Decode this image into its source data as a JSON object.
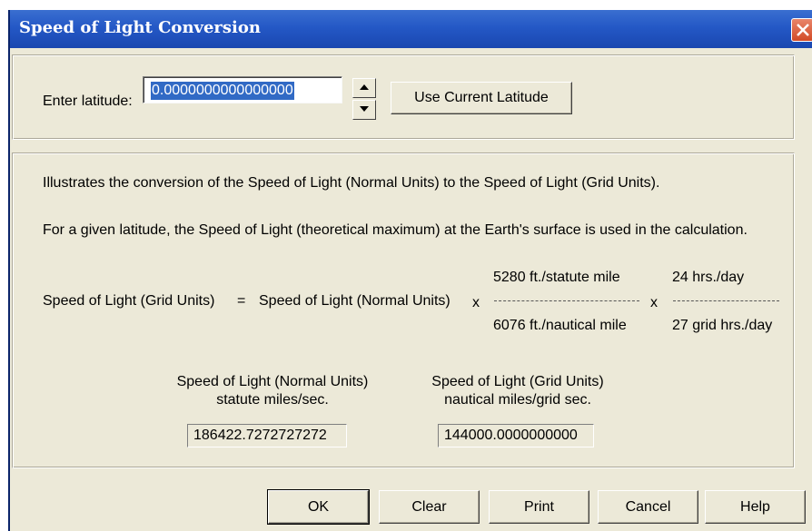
{
  "window": {
    "title": "Speed of Light Conversion",
    "close_label": "close"
  },
  "latitude": {
    "label": "Enter latitude:",
    "value": "0.0000000000000000",
    "use_current_label": "Use Current Latitude"
  },
  "info": {
    "line1": "Illustrates the conversion of the Speed of Light (Normal Units) to the Speed of Light (Grid Units).",
    "line2": "For a given latitude, the Speed of Light (theoretical maximum) at the Earth's surface is used in the calculation."
  },
  "formula": {
    "lhs": "Speed of Light (Grid Units)",
    "equals": "=",
    "rhs": "Speed of Light (Normal Units)",
    "times1": "x",
    "fraction1_numerator": "5280 ft./statute mile",
    "fraction1_denominator": "6076 ft./nautical mile",
    "times2": "x",
    "fraction2_numerator": "24 hrs./day",
    "fraction2_denominator": "27 grid hrs./day"
  },
  "results": {
    "normal_title": "Speed of Light (Normal Units)",
    "normal_units": "statute miles/sec.",
    "normal_value": "186422.7272727272",
    "grid_title": "Speed of Light (Grid Units)",
    "grid_units": "nautical miles/grid sec.",
    "grid_value": "144000.0000000000"
  },
  "buttons": {
    "ok": "OK",
    "clear": "Clear",
    "print": "Print",
    "cancel": "Cancel",
    "help": "Help"
  },
  "colors": {
    "titlebar": "#2458c6",
    "dialog_face": "#ece9d8",
    "selection": "#316ac5",
    "close_button": "#d24a26"
  }
}
